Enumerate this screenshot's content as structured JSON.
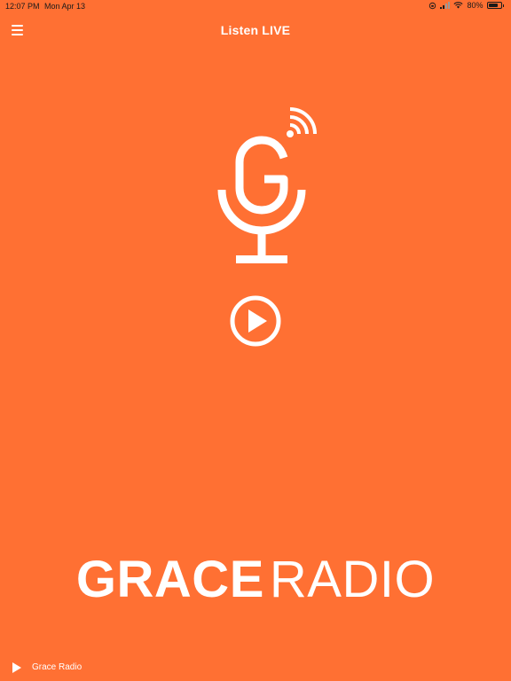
{
  "status_bar": {
    "time": "12:07 PM",
    "date": "Mon Apr 13",
    "battery_percent": "80%",
    "battery_level": 0.8,
    "icons": [
      "rotation-lock-icon",
      "signal-icon",
      "wifi-icon",
      "battery-icon"
    ]
  },
  "nav": {
    "menu_icon": "hamburger-menu-icon",
    "title": "Listen LIVE"
  },
  "main": {
    "logo_icon": "microphone-logo-icon",
    "play_icon": "play-circle-icon"
  },
  "brand": {
    "word_1": "GRACE",
    "word_2": "RADIO"
  },
  "mini_player": {
    "play_icon": "play-icon",
    "station_name": "Grace Radio"
  },
  "colors": {
    "background": "#FF7033",
    "foreground": "#FFFFFF",
    "status_text": "#1A1A1A"
  }
}
